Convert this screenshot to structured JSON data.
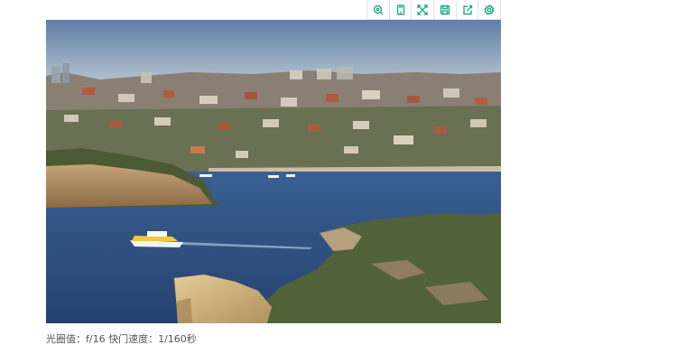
{
  "toolbar": {
    "buttons": [
      {
        "icon": "zoom-icon"
      },
      {
        "icon": "mobile-icon"
      },
      {
        "icon": "fullscreen-icon"
      },
      {
        "icon": "save-icon"
      },
      {
        "icon": "share-icon"
      },
      {
        "icon": "settings-icon"
      }
    ],
    "accent_color": "#26a98a"
  },
  "photo": {
    "subject": "harbour-photo"
  },
  "caption": {
    "text": "光圈值：f/16 快门速度：1/160秒"
  }
}
